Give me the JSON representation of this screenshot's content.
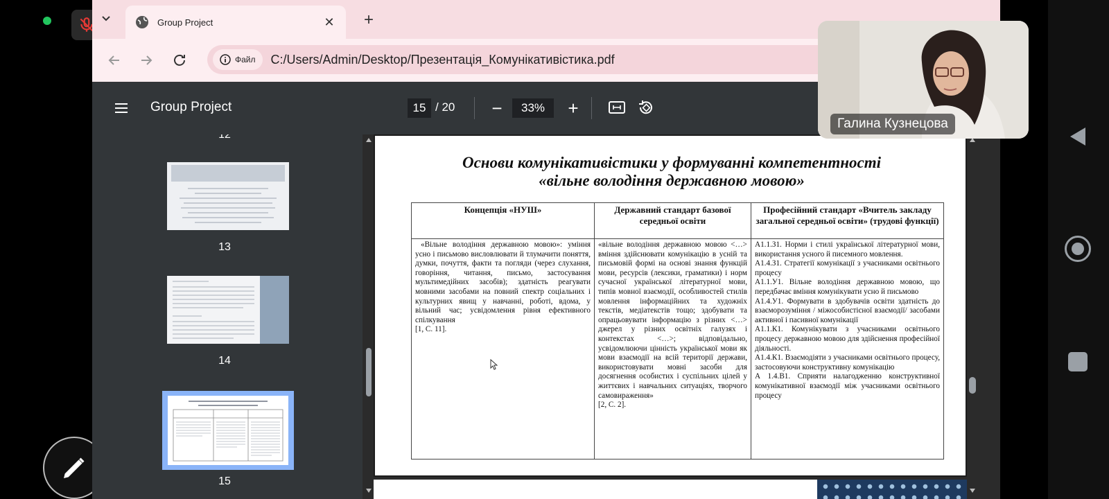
{
  "browser": {
    "tab_title": "Group Project",
    "tab_close": "✕",
    "new_tab": "+",
    "site_chip": "Файл",
    "url": "C:/Users/Admin/Desktop/Презентація_Комунікативістика.pdf"
  },
  "pdf": {
    "title": "Group Project",
    "current_page": "15",
    "total_pages": "/ 20",
    "zoom": "33%",
    "zoom_minus": "−",
    "zoom_plus": "+"
  },
  "sidebar": {
    "thumb_labels": [
      "12",
      "13",
      "14",
      "15"
    ]
  },
  "slide": {
    "title_line1": "Основи комунікативістики у формуванні компетентності",
    "title_line2": "«вільне володіння державною мовою»",
    "headers": [
      "Концепція «НУШ»",
      "Державний стандарт базової середньої освіти",
      "Професійний стандарт «Вчитель закладу загальної середньої освіти» (трудові функції)"
    ],
    "col1": "«Вільне володіння державною мовою»: уміння усно і письмово висловлювати й тлумачити поняття, думки, почуття, факти та погляди (через слухання, говоріння, читання, письмо, застосування мультимедійних засобів); здатність реагувати мовними засобами на повний спектр соціальних і культурних явищ у навчанні, роботі, вдома, у вільний час; усвідомлення рівня ефективного спілкування",
    "col1_ref": "[1, С. 11].",
    "col2": "«вільне володіння державною мовою <…> вміння здійснювати комунікацію в усній та письмовій формі на основі знання функцій мови, ресурсів (лексики, граматики) і норм сучасної української літературної мови, типів мовної взаємодії, особливостей стилів мовлення інформаційних та художніх текстів, медіатекстів тощо; здобувати та опрацьовувати інформацію з різних <…> джерел у різних освітніх галузях і контекстах <…>; відповідально, усвідомлюючи цінність української мови як мови взаємодії на всій території держави, використовувати мовні засоби для досягнення особистих і суспільних цілей у життєвих і навчальних ситуаціях, творчого самовираження»",
    "col2_ref": "[2, С. 2].",
    "col3_items": [
      "А1.1.З1. Норми і стилі української літературної мови, використання усного й писемного мовлення.",
      "А1.4.З1. Стратегії комунікації з учасниками освітнього процесу",
      "А1.1.У1. Вільне володіння державною мовою, що передбачає вміння комунікувати усно й письмово",
      "А1.4.У1. Формувати в здобувачів освіти здатність до взаєморозуміння / міжособистісної взаємодії/ засобами активної і пасивної комунікації",
      "А1.1.К1. Комунікувати з учасниками освітнього процесу державною мовою для здійснення професійної діяльності.",
      "А1.4.К1. Взаємодіяти з учасниками освітнього процесу, застосовуючи конструктивну комунікацію",
      "А 1.4.В1. Сприяти налагодженню конструктивної комунікативної взаємодії між учасниками освітнього процесу"
    ]
  },
  "video": {
    "participant_name": "Галина Кузнецова"
  },
  "colors": {
    "tabbar": "#f7dde2",
    "pdf_toolbar": "#323639",
    "selected_thumb": "#8ab4f8"
  }
}
